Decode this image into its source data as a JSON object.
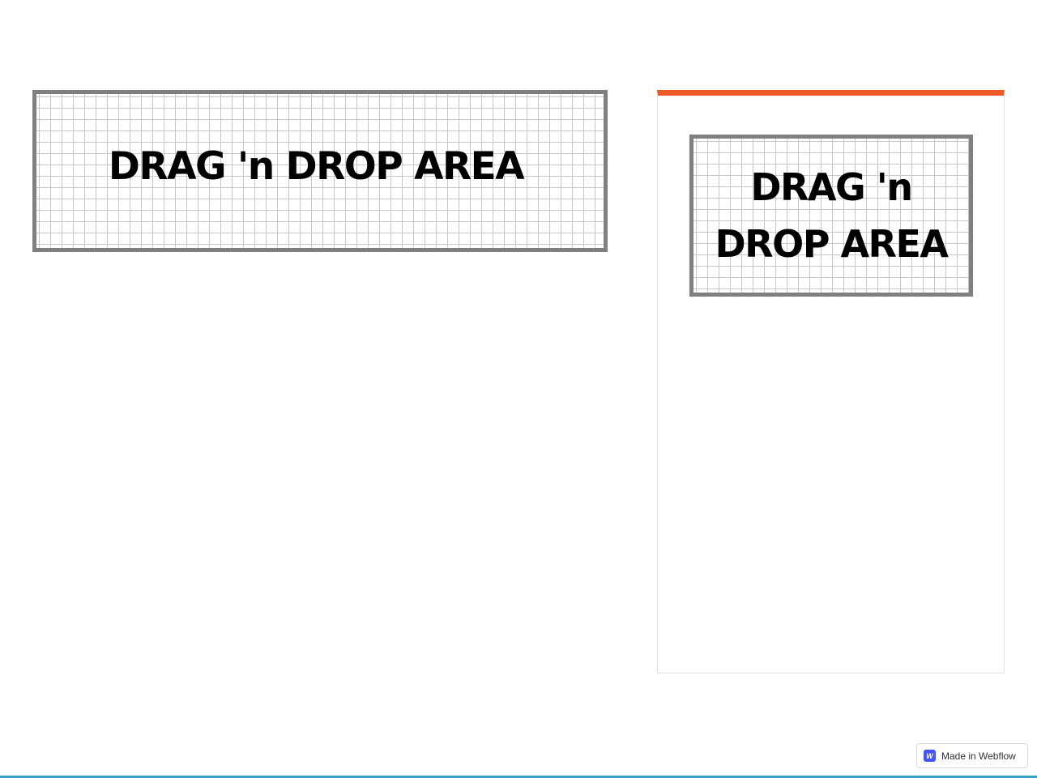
{
  "main_drop_area": {
    "label": "DRAG 'n DROP AREA"
  },
  "side_panel": {
    "accent_color": "#ee5a24",
    "drop_area": {
      "label_line1": "DRAG 'n",
      "label_line2": "DROP AREA"
    }
  },
  "badge": {
    "icon": "webflow-icon",
    "icon_glyph": "W",
    "label": "Made in Webflow"
  }
}
